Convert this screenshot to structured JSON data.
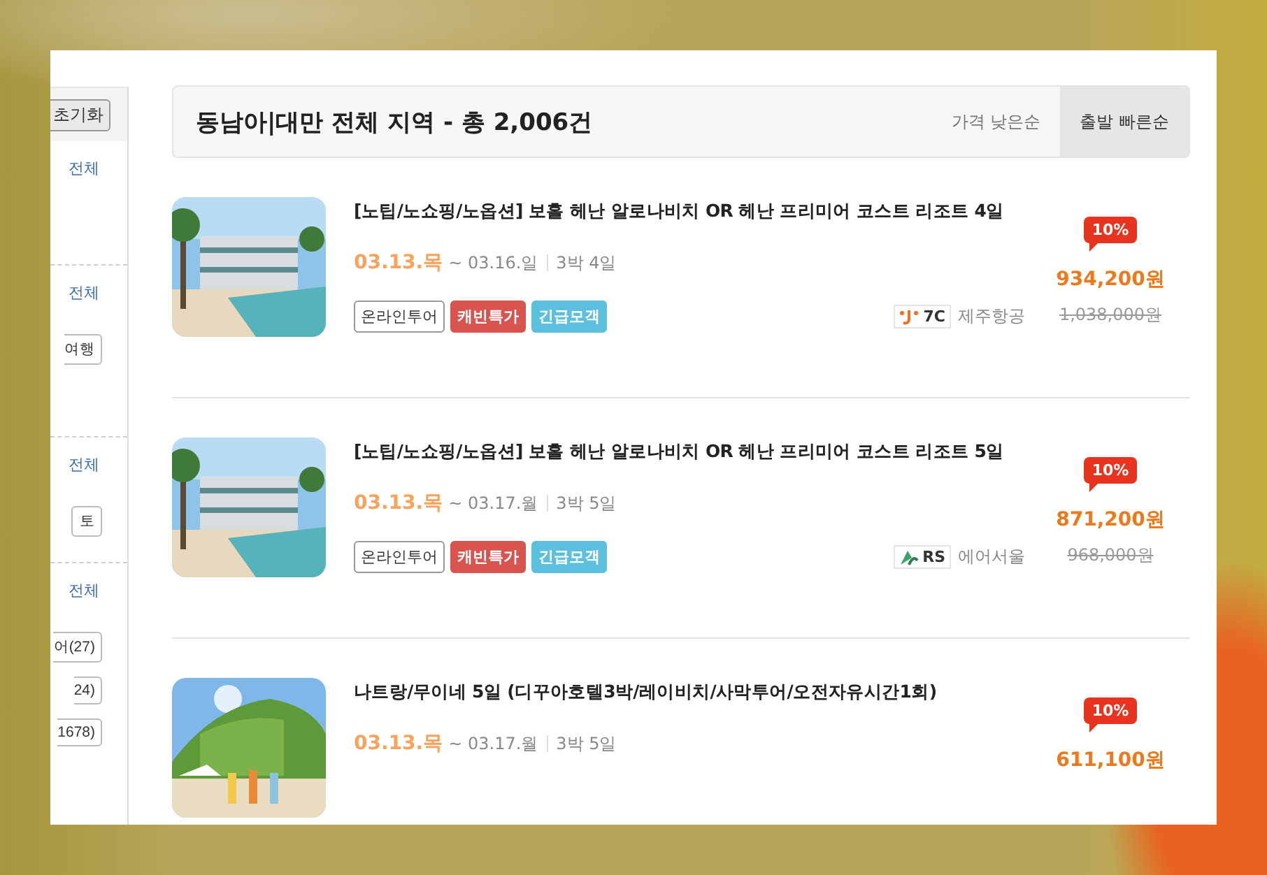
{
  "sidebar": {
    "reset_button": "초기화",
    "sections": [
      {
        "all_link": "전체"
      },
      {
        "all_link": "전체",
        "chips": [
          {
            "label": "여행",
            "cut": true
          }
        ]
      },
      {
        "all_link": "전체",
        "chips": [
          {
            "label": "토",
            "cut": false
          }
        ]
      },
      {
        "all_link": "전체",
        "chips": [
          {
            "label": "어(27)",
            "cut": true
          },
          {
            "label": "24)",
            "cut": true
          },
          {
            "label": "1678)",
            "cut": true
          }
        ]
      }
    ]
  },
  "header": {
    "title": "동남아|대만 전체 지역 - 총 2,006건",
    "sort_options": [
      {
        "label": "가격 낮은순",
        "selected": false
      },
      {
        "label": "출발 빠른순",
        "selected": true
      }
    ]
  },
  "products": [
    {
      "title": "[노팁/노쇼핑/노옵션] 보홀 헤난 알로나비치 OR 헤난 프리미어 코스트 리조트 4일",
      "depart": "03.13.목",
      "return": "~ 03.16.일",
      "duration": "3박 4일",
      "tags": [
        {
          "label": "온라인투어",
          "kind": "outline"
        },
        {
          "label": "캐빈특가",
          "kind": "filled",
          "color": "#d9534f"
        },
        {
          "label": "긴급모객",
          "kind": "filled",
          "color": "#5bc0de"
        }
      ],
      "airline": {
        "code": "7C",
        "name": "제주항공"
      },
      "discount": "10%",
      "price": "934,200원",
      "original_price": "1,038,000원"
    },
    {
      "title": "[노팁/노쇼핑/노옵션] 보홀 헤난 알로나비치 OR 헤난 프리미어 코스트 리조트 5일",
      "depart": "03.13.목",
      "return": "~ 03.17.월",
      "duration": "3박 5일",
      "tags": [
        {
          "label": "온라인투어",
          "kind": "outline"
        },
        {
          "label": "캐빈특가",
          "kind": "filled",
          "color": "#d9534f"
        },
        {
          "label": "긴급모객",
          "kind": "filled",
          "color": "#5bc0de"
        }
      ],
      "airline": {
        "code": "RS",
        "name": "에어서울"
      },
      "discount": "10%",
      "price": "871,200원",
      "original_price": "968,000원"
    },
    {
      "title": "나트랑/무이네 5일 (디꾸아호텔3박/레이비치/사막투어/오전자유시간1회)",
      "depart": "03.13.목",
      "return": "~ 03.17.월",
      "duration": "3박 5일",
      "discount": "10%",
      "price": "611,100원"
    }
  ]
}
